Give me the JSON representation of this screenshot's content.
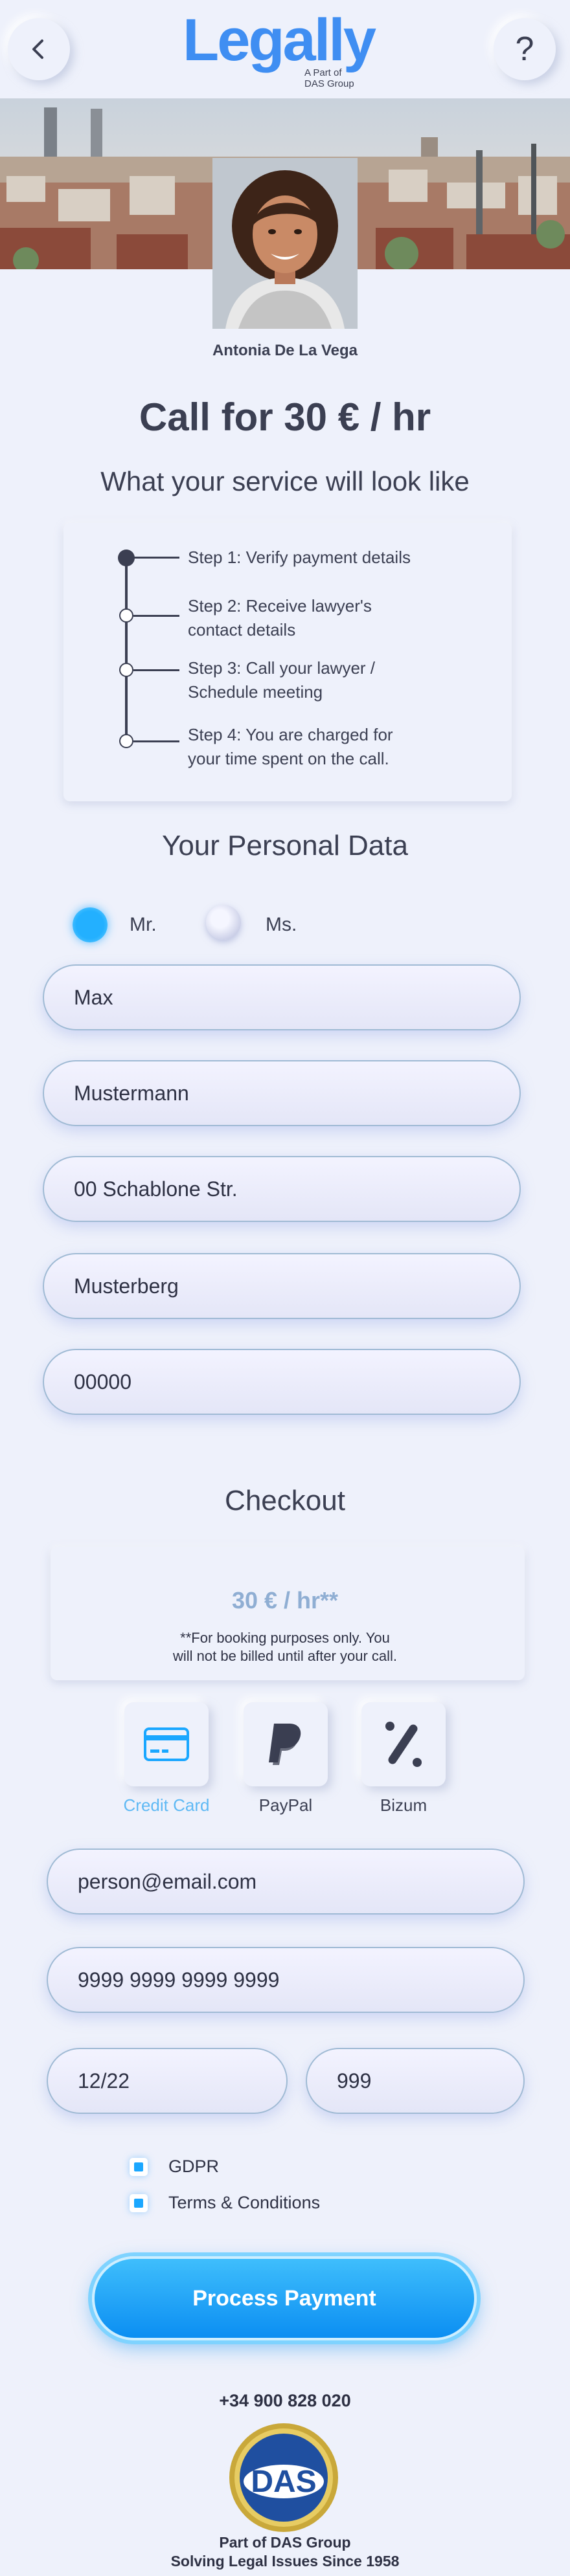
{
  "header": {
    "back_icon": "chevron-left-icon",
    "help_label": "?",
    "brand": "Legally",
    "brand_sub_line1": "A Part of",
    "brand_sub_line2": "DAS Group"
  },
  "lawyer": {
    "name": "Antonia De La Vega"
  },
  "offer": {
    "title": "Call for 30 € / hr"
  },
  "steps": {
    "heading": "What your service will look like",
    "items": [
      "Step 1: Verify payment details",
      "Step 2: Receive lawyer's contact details",
      "Step 3: Call your lawyer / Schedule meeting",
      "Step 4: You are charged for your time spent on the call."
    ],
    "items_line2": [
      "",
      "contact details",
      "Schedule meeting",
      "your time spent on the call."
    ],
    "items_line1": [
      "Step 1: Verify payment details",
      "Step 2: Receive lawyer's",
      "Step 3: Call your lawyer /",
      "Step 4: You are charged for"
    ]
  },
  "personal": {
    "heading": "Your Personal Data",
    "salutation_mr": "Mr.",
    "salutation_ms": "Ms.",
    "selected": "Mr.",
    "first_name": "Max",
    "last_name": "Mustermann",
    "street": "00 Schablone Str.",
    "city": "Musterberg",
    "zip": "00000"
  },
  "checkout": {
    "heading": "Checkout",
    "price": "30 € / hr**",
    "note_line1": "**For booking purposes only. You",
    "note_line2": "will not be billed until after your call.",
    "methods": [
      {
        "label": "Credit Card",
        "icon": "credit-card-icon",
        "selected": true
      },
      {
        "label": "PayPal",
        "icon": "paypal-icon",
        "selected": false
      },
      {
        "label": "Bizum",
        "icon": "bizum-icon",
        "selected": false
      }
    ],
    "email": "person@email.com",
    "card_number": "9999 9999 9999 9999",
    "expiry": "12/22",
    "cvv": "999",
    "checkbox_gdpr": "GDPR",
    "checkbox_terms": "Terms & Conditions",
    "process_label": "Process Payment"
  },
  "footer": {
    "phone": "+34 900 828 020",
    "das_logo_text": "DAS",
    "line1": "Part of DAS Group",
    "line2": "Solving Legal Issues Since 1958"
  },
  "colors": {
    "background": "#eef1fb",
    "brand_blue": "#3f8ef2",
    "accent": "#1aa7ff",
    "text": "#3b3f52"
  }
}
